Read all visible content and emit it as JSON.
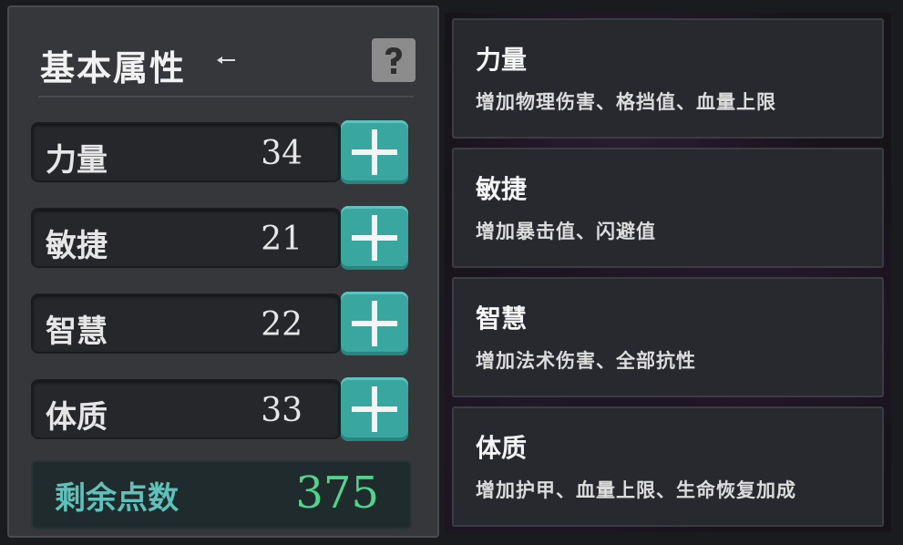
{
  "panel": {
    "title": "基本属性",
    "help_icon": "question-mark-icon"
  },
  "stats": [
    {
      "name": "力量",
      "value": "34"
    },
    {
      "name": "敏捷",
      "value": "21"
    },
    {
      "name": "智慧",
      "value": "22"
    },
    {
      "name": "体质",
      "value": "33"
    }
  ],
  "points": {
    "label": "剩余点数",
    "value": "375"
  },
  "descriptions": [
    {
      "title": "力量",
      "text": "增加物理伤害、格挡值、血量上限"
    },
    {
      "title": "敏捷",
      "text": "增加暴击值、闪避值"
    },
    {
      "title": "智慧",
      "text": "增加法术伤害、全部抗性"
    },
    {
      "title": "体质",
      "text": "增加护甲、血量上限、生命恢复加成"
    }
  ],
  "colors": {
    "accent_teal": "#3aa6a0",
    "points_green": "#4fd48b",
    "points_label": "#5fc2ba"
  }
}
